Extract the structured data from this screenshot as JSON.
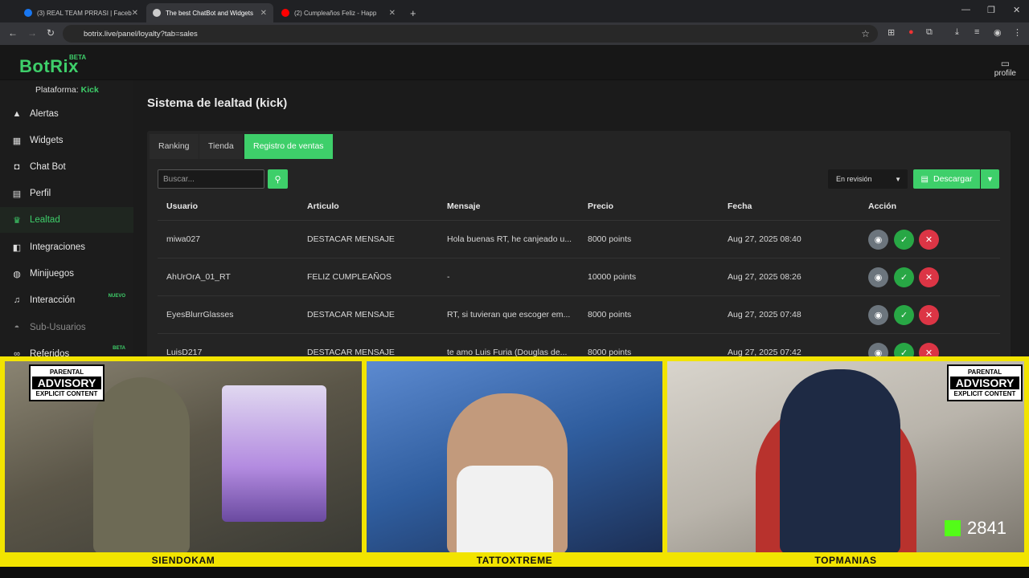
{
  "browser": {
    "tabs": [
      {
        "label": "(3) REAL TEAM PRRASI | Facebo",
        "favicon": "facebook-icon",
        "color": "#1877f2"
      },
      {
        "label": "The best ChatBot and Widgets",
        "favicon": "botrix-icon",
        "color": "#cccccc"
      },
      {
        "label": "(2) Cumpleaños Feliz - Happ",
        "favicon": "youtube-icon",
        "color": "#ff0000"
      }
    ],
    "new_tab": "+",
    "url": "botrix.live/panel/loyalty?tab=sales"
  },
  "app": {
    "logo": "BotRix",
    "logo_badge": "BETA",
    "profile_label": "profile"
  },
  "sidebar": {
    "platform_label": "Plataforma:",
    "platform_value": "Kick",
    "items": [
      {
        "label": "Alertas",
        "icon": "warning-icon"
      },
      {
        "label": "Widgets",
        "icon": "grid-icon"
      },
      {
        "label": "Chat Bot",
        "icon": "robot-icon"
      },
      {
        "label": "Perfil",
        "icon": "id-card-icon"
      },
      {
        "label": "Lealtad",
        "icon": "trophy-icon",
        "active": true
      },
      {
        "label": "Integraciones",
        "icon": "plug-icon"
      },
      {
        "label": "Minijuegos",
        "icon": "gamepad-icon"
      },
      {
        "label": "Interacción",
        "icon": "music-icon",
        "badge": "NUEVO"
      },
      {
        "label": "Sub-Usuarios",
        "icon": "users-icon",
        "muted": true
      },
      {
        "label": "Referidos",
        "icon": "link-icon",
        "badge": "BETA"
      }
    ]
  },
  "main": {
    "title": "Sistema de lealtad (kick)",
    "tabs": [
      "Ranking",
      "Tienda",
      "Registro de ventas"
    ],
    "search_placeholder": "Buscar...",
    "status_filter": "En revisión",
    "download_label": "Descargar",
    "columns": [
      "Usuario",
      "Articulo",
      "Mensaje",
      "Precio",
      "Fecha",
      "Acción"
    ],
    "rows": [
      {
        "user": "miwa027",
        "item": "DESTACAR MENSAJE",
        "message": "Hola buenas RT, he canjeado u...",
        "price": "8000 points",
        "date": "Aug 27, 2025 08:40"
      },
      {
        "user": "AhUrOrA_01_RT",
        "item": "FELIZ CUMPLEAÑOS",
        "message": "-",
        "price": "10000 points",
        "date": "Aug 27, 2025 08:26"
      },
      {
        "user": "EyesBlurrGlasses",
        "item": "DESTACAR MENSAJE",
        "message": "RT, si tuvieran que escoger em...",
        "price": "8000 points",
        "date": "Aug 27, 2025 07:48"
      },
      {
        "user": "LuisD217",
        "item": "DESTACAR MENSAJE",
        "message": "te amo Luis Furia (Douglas de...",
        "price": "8000 points",
        "date": "Aug 27, 2025 07:42"
      }
    ]
  },
  "stream": {
    "cams": [
      {
        "name": "SIENDOKAM",
        "bg": "#6e6a5c"
      },
      {
        "name": "TATTOXTREME",
        "bg": "#2f5d9e"
      },
      {
        "name": "TOPMANIAS",
        "bg": "#b9b4ab"
      }
    ],
    "advisory_top": "PARENTAL",
    "advisory_mid": "ADVISORY",
    "advisory_bottom": "EXPLICIT CONTENT",
    "viewer_count": "2841"
  },
  "colors": {
    "accent": "#3ecf6a",
    "overlay_yellow": "#f2e400",
    "danger": "#dc3545",
    "success": "#28a745"
  }
}
